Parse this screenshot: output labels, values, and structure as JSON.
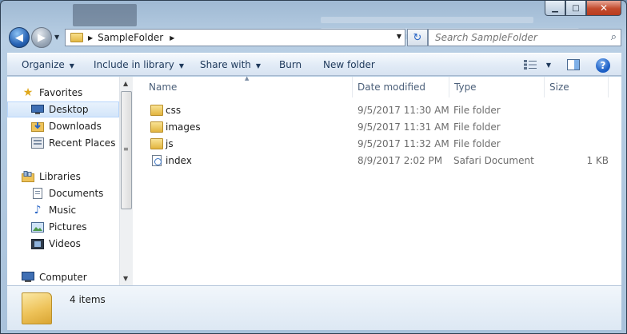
{
  "window": {
    "caption_buttons": {
      "minimize": "▁",
      "maximize": "□",
      "close": "✕"
    }
  },
  "address_bar": {
    "path": [
      "SampleFolder"
    ],
    "refresh_glyph": "↻"
  },
  "search": {
    "placeholder": "Search SampleFolder",
    "value": ""
  },
  "toolbar": {
    "organize": "Organize",
    "include_in_library": "Include in library",
    "share_with": "Share with",
    "burn": "Burn",
    "new_folder": "New folder",
    "help": "?"
  },
  "nav_pane": {
    "favorites": "Favorites",
    "desktop": "Desktop",
    "downloads": "Downloads",
    "recent_places": "Recent Places",
    "libraries": "Libraries",
    "documents": "Documents",
    "music": "Music",
    "pictures": "Pictures",
    "videos": "Videos",
    "computer": "Computer",
    "selected": "Desktop"
  },
  "columns": {
    "name": "Name",
    "date_modified": "Date modified",
    "type": "Type",
    "size": "Size"
  },
  "files": [
    {
      "name": "css",
      "date": "9/5/2017 11:30 AM",
      "type": "File folder",
      "size": "",
      "icon": "folder-icon"
    },
    {
      "name": "images",
      "date": "9/5/2017 11:31 AM",
      "type": "File folder",
      "size": "",
      "icon": "folder-icon"
    },
    {
      "name": "js",
      "date": "9/5/2017 11:32 AM",
      "type": "File folder",
      "size": "",
      "icon": "folder-icon"
    },
    {
      "name": "index",
      "date": "8/9/2017 2:02 PM",
      "type": "Safari Document",
      "size": "1 KB",
      "icon": "safari-document-icon"
    }
  ],
  "status": {
    "item_count": "4 items"
  },
  "colors": {
    "toolbar_text": "#1e395b",
    "selection_bg": "#d3e5fa",
    "column_header_text": "#4c607a",
    "folder_yellow": "#e2b43f"
  }
}
